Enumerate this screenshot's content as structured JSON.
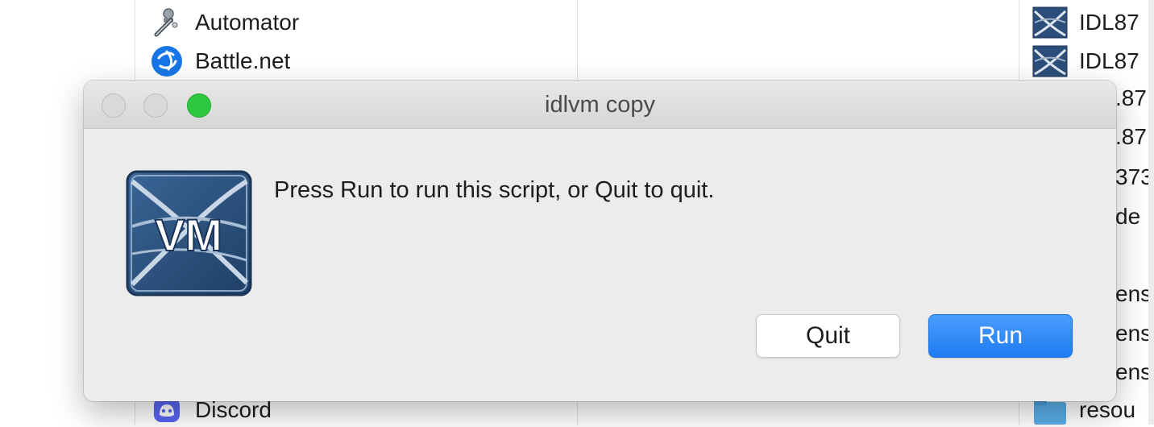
{
  "finder": {
    "apps": [
      {
        "label": "Automator",
        "icon": "automator-icon"
      },
      {
        "label": "Battle.net",
        "icon": "battlenet-icon"
      },
      {
        "label": "Discord",
        "icon": "discord-icon"
      }
    ],
    "files": [
      {
        "label": "IDL87",
        "icon": "idl-file-icon"
      },
      {
        "label": "IDL87",
        "icon": "idl-file-icon"
      },
      {
        "label": "resou",
        "icon": "folder-icon"
      }
    ],
    "partial_labels": [
      ".87",
      ".87",
      "373",
      "de",
      "ens",
      "ens",
      "ens"
    ]
  },
  "dialog": {
    "title": "idlvm copy",
    "message": "Press Run to run this script, or Quit to quit.",
    "app_icon": "idl-vm-icon",
    "icon_text": "VM",
    "quit_label": "Quit",
    "run_label": "Run"
  },
  "colors": {
    "run_button": "#1e7bf2",
    "zoom_button": "#2dc840",
    "dialog_background": "#ececec"
  }
}
